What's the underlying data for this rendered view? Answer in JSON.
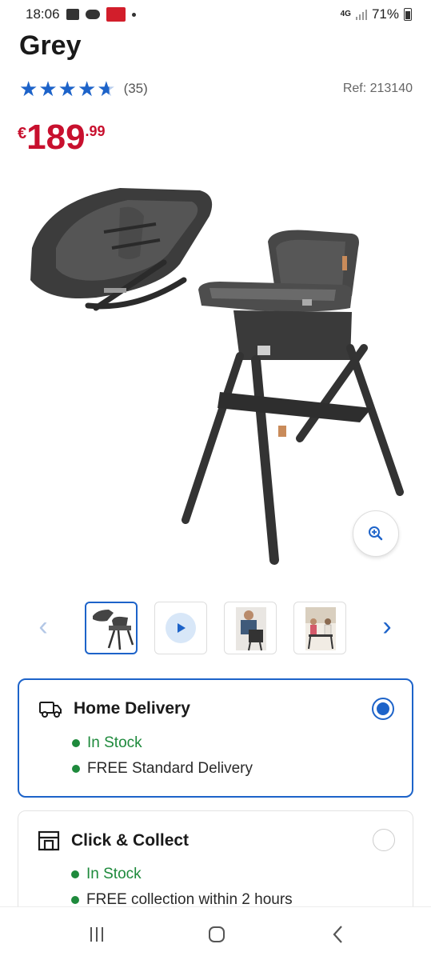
{
  "status_bar": {
    "time": "18:06",
    "network": "4G",
    "battery": "71%"
  },
  "product": {
    "title": "Grey",
    "rating": 4.6,
    "review_count": "(35)",
    "ref": "Ref: 213140",
    "price": {
      "currency": "€",
      "main": "189",
      "cents": ".99"
    }
  },
  "gallery": {
    "thumbnails": [
      {
        "kind": "image",
        "selected": true
      },
      {
        "kind": "video",
        "selected": false
      },
      {
        "kind": "image",
        "selected": false
      },
      {
        "kind": "image",
        "selected": false
      }
    ]
  },
  "delivery": {
    "home": {
      "title": "Home Delivery",
      "stock": "In Stock",
      "note": "FREE Standard Delivery",
      "selected": true
    },
    "collect": {
      "title": "Click & Collect",
      "stock": "In Stock",
      "note": "FREE collection within 2 hours",
      "selected": false
    }
  },
  "colors": {
    "accent": "#1d63c9",
    "price": "#c8102e",
    "in_stock": "#1e8a3c"
  }
}
